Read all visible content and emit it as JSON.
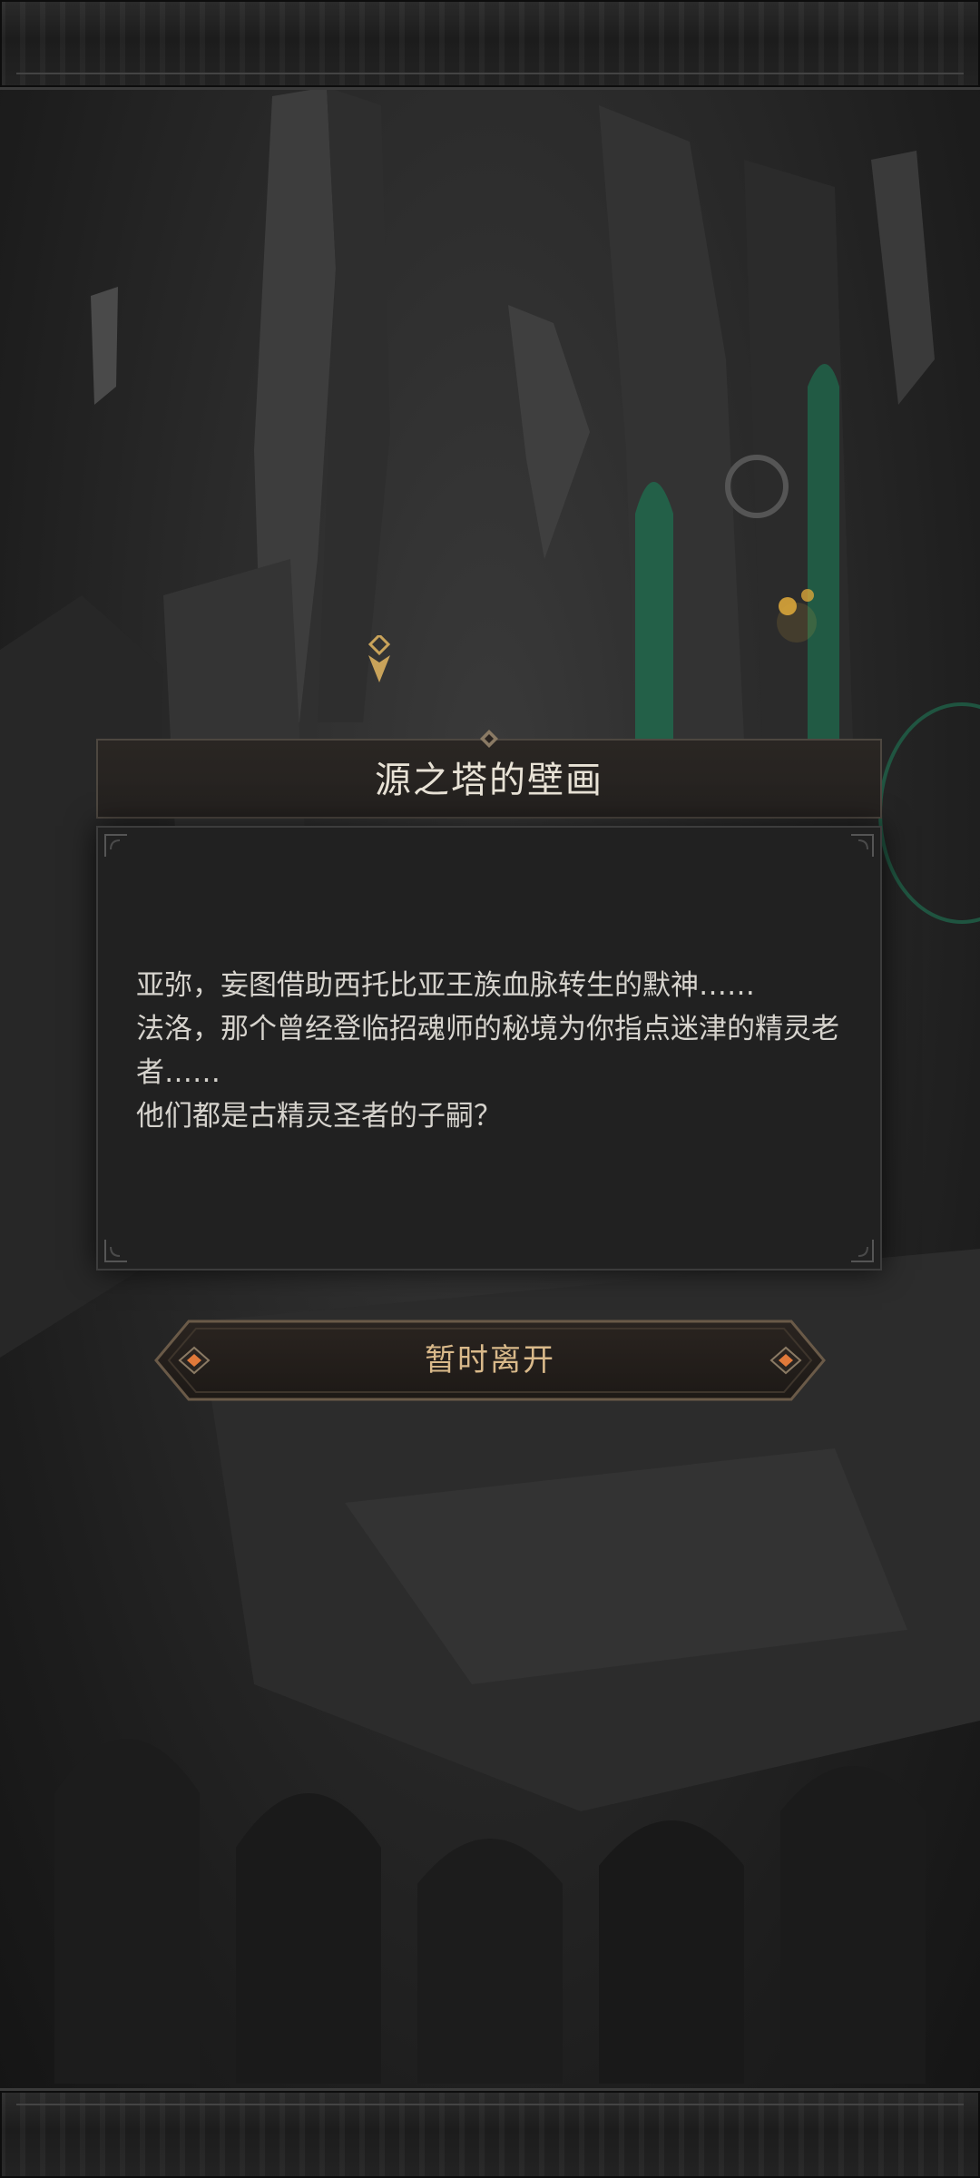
{
  "dialog": {
    "title": "源之塔的壁画",
    "lines": [
      "亚弥，妄图借助西托比亚王族血脉转生的默神……",
      "法洛，那个曾经登临招魂师的秘境为你指点迷津的精灵老者……",
      "他们都是古精灵圣者的子嗣？"
    ]
  },
  "actions": {
    "leave_label": "暂时离开"
  },
  "colors": {
    "title_text": "#e8e2d6",
    "body_text": "#d6d3cd",
    "button_text": "#d9b98a",
    "accent_gem": "#e0793a",
    "window_glow": "#1f6b4e",
    "candle_light": "#d9a53a"
  },
  "icons": {
    "waypoint": "waypoint-marker-icon",
    "gem": "diamond-gem-icon"
  }
}
